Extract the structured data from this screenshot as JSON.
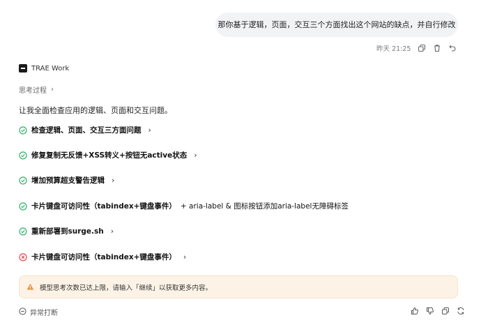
{
  "user_message": "那你基于逻辑，页面，交互三个方面找出这个网站的缺点，并自行修改",
  "message_time": "昨天 21:25",
  "assistant": {
    "name": "TRAE Work",
    "thinking_label": "思考过程",
    "intro": "让我全面检查应用的逻辑、页面和交互问题。"
  },
  "steps": [
    {
      "status": "success",
      "label": "检查逻辑、页面、交互三方面问题"
    },
    {
      "status": "success",
      "label": "修复复制无反馈+XSS转义+按钮无active状态"
    },
    {
      "status": "success",
      "label": "增加预算超支警告逻辑"
    },
    {
      "status": "success",
      "label": "卡片键盘可访问性（tabindex+键盘事件）",
      "extra": "+ aria-label & 图标按钮添加aria-label无障碍标签"
    },
    {
      "status": "success",
      "label": "重新部署到surge.sh"
    },
    {
      "status": "error",
      "label": "卡片键盘可访问性（tabindex+键盘事件）"
    }
  ],
  "notice": "模型思考次数已达上限，请输入「继续」以获取更多内容。",
  "footer": {
    "interrupted_label": "异常打断"
  },
  "colors": {
    "success": "#2fb36b",
    "error": "#e5484d",
    "warning": "#e8913a",
    "notice_bg": "#fdf2e6"
  }
}
